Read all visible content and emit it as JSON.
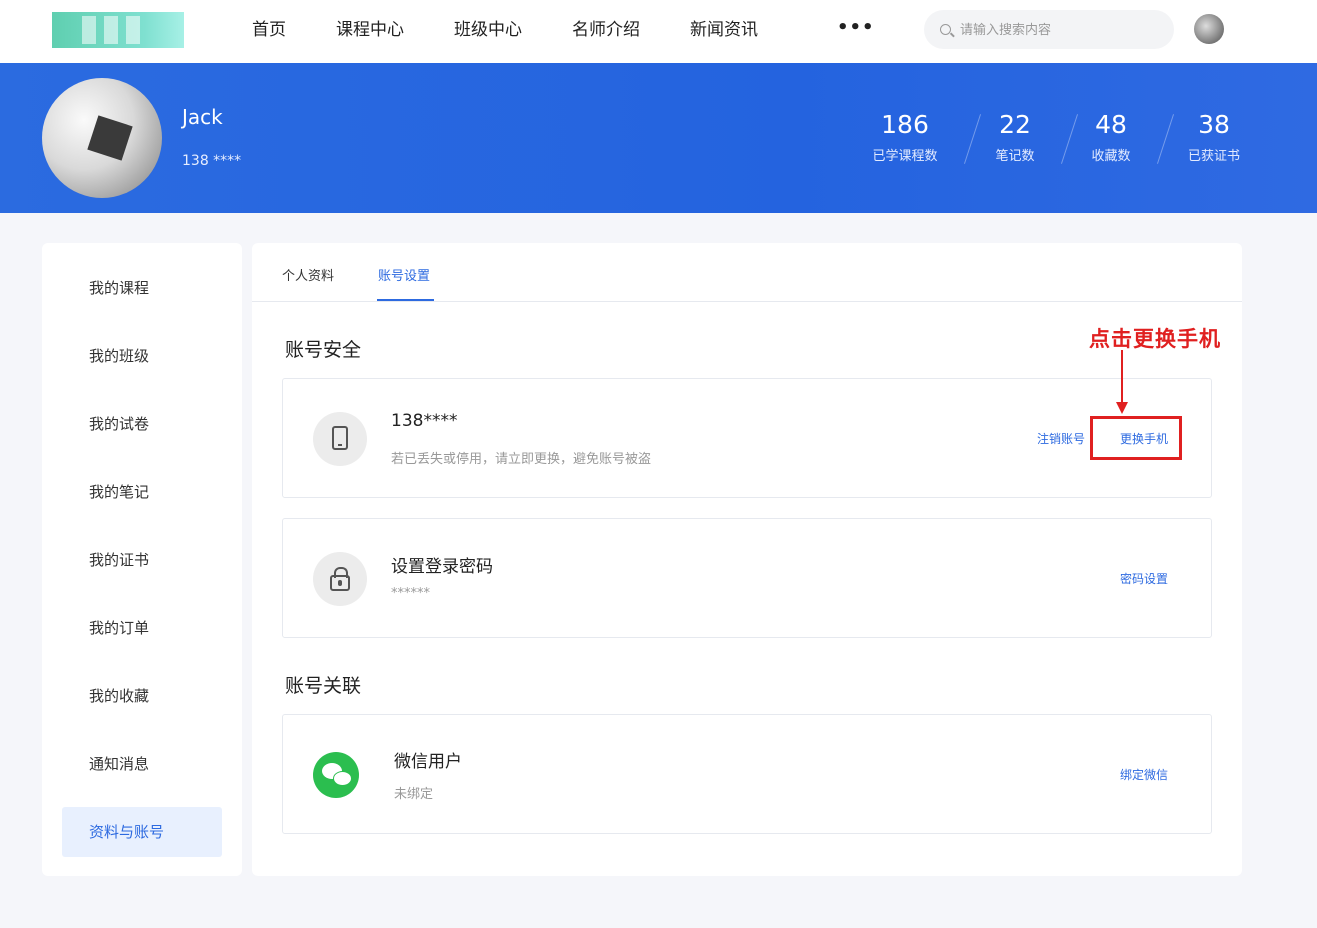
{
  "nav": {
    "items": [
      "首页",
      "课程中心",
      "班级中心",
      "名师介绍",
      "新闻资讯"
    ],
    "more": "•••",
    "search_placeholder": "请输入搜索内容"
  },
  "profile": {
    "name": "Jack",
    "phone": "138 ****"
  },
  "stats": [
    {
      "value": "186",
      "label": "已学课程数"
    },
    {
      "value": "22",
      "label": "笔记数"
    },
    {
      "value": "48",
      "label": "收藏数"
    },
    {
      "value": "38",
      "label": "已获证书"
    }
  ],
  "sidebar": {
    "items": [
      "我的课程",
      "我的班级",
      "我的试卷",
      "我的笔记",
      "我的证书",
      "我的订单",
      "我的收藏",
      "通知消息",
      "资料与账号"
    ],
    "active": "资料与账号"
  },
  "tabs": [
    "个人资料",
    "账号设置"
  ],
  "active_tab": "账号设置",
  "security": {
    "title": "账号安全",
    "phone": {
      "value": "138****",
      "hint": "若已丢失或停用，请立即更换，避免账号被盗",
      "cancel_label": "注销账号",
      "change_label": "更换手机"
    },
    "password": {
      "title": "设置登录密码",
      "value": "******",
      "action_label": "密码设置"
    }
  },
  "linked": {
    "title": "账号关联",
    "wechat": {
      "title": "微信用户",
      "status": "未绑定",
      "action_label": "绑定微信"
    }
  },
  "annotation": {
    "text": "点击更换手机",
    "color": "#e02020"
  },
  "colors": {
    "accent": "#2d6ae0",
    "banner": "#2463df",
    "wechat": "#2bbe4f"
  }
}
